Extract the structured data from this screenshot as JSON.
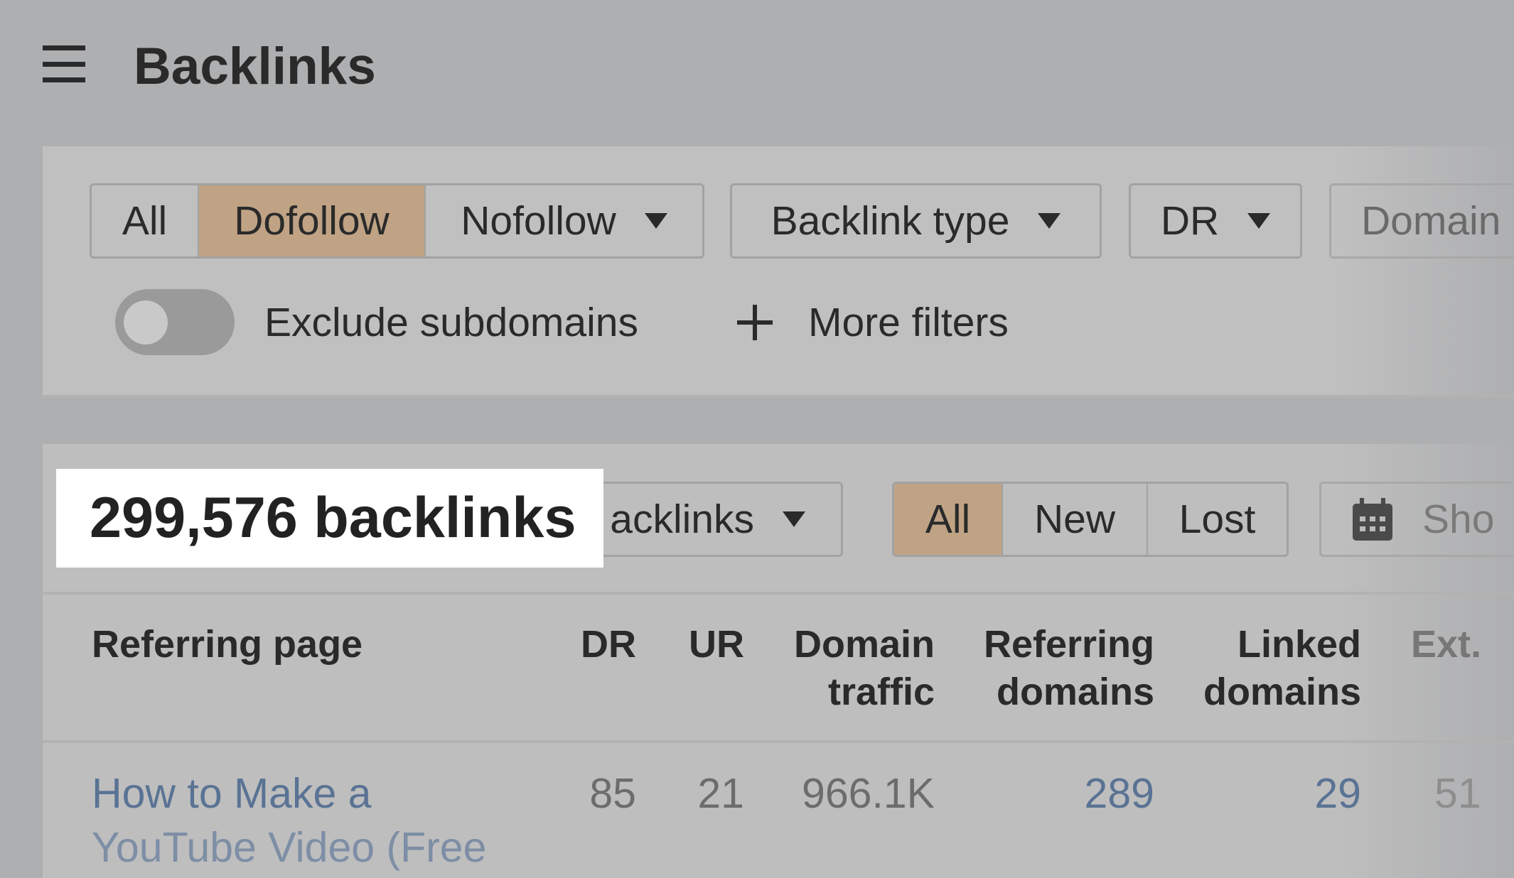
{
  "header": {
    "title": "Backlinks",
    "menu_icon": "hamburger-icon"
  },
  "filters": {
    "link_type": [
      "All",
      "Dofollow",
      "Nofollow"
    ],
    "active_link_type": "Dofollow",
    "backlink_type": "Backlink type",
    "dr": "DR",
    "domain": "Domain",
    "exclude_subdomains": "Exclude subdomains",
    "exclude_subdomains_on": false,
    "more_filters": "More filters"
  },
  "results": {
    "count_label": "299,576 backlinks",
    "view_dropdown": "acklinks",
    "period_tabs": [
      "All",
      "New",
      "Lost"
    ],
    "active_period": "All",
    "date_button": "Sho"
  },
  "colors": {
    "active": "#bfa384",
    "link": "#5a7394"
  },
  "table": {
    "columns": [
      {
        "line1": "Referring page",
        "line2": ""
      },
      {
        "line1": "DR",
        "line2": ""
      },
      {
        "line1": "UR",
        "line2": ""
      },
      {
        "line1": "Domain",
        "line2": "traffic"
      },
      {
        "line1": "Referring",
        "line2": "domains"
      },
      {
        "line1": "Linked",
        "line2": "domains"
      },
      {
        "line1": "Ext.",
        "line2": ""
      }
    ],
    "rows": [
      {
        "page_line1": "How to Make a",
        "page_line2": "YouTube Video (Free",
        "dr": "85",
        "ur": "21",
        "domain_traffic": "966.1K",
        "referring_domains": "289",
        "linked_domains": "29",
        "ext": "51"
      }
    ]
  }
}
